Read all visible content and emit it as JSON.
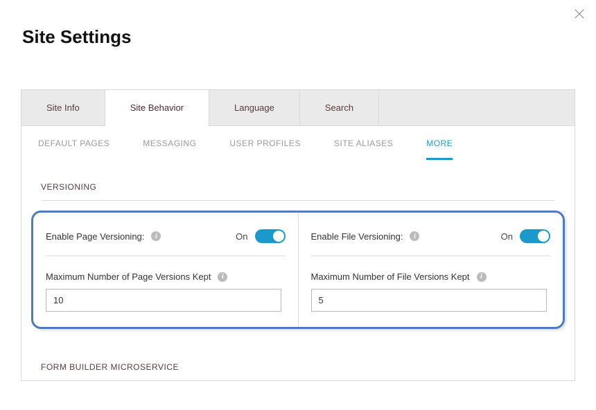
{
  "header": {
    "title": "Site Settings"
  },
  "primaryTabs": [
    {
      "label": "Site Info",
      "active": false
    },
    {
      "label": "Site Behavior",
      "active": true
    },
    {
      "label": "Language",
      "active": false
    },
    {
      "label": "Search",
      "active": false
    }
  ],
  "subTabs": [
    {
      "label": "DEFAULT PAGES",
      "active": false
    },
    {
      "label": "MESSAGING",
      "active": false
    },
    {
      "label": "USER PROFILES",
      "active": false
    },
    {
      "label": "SITE ALIASES",
      "active": false
    },
    {
      "label": "MORE",
      "active": true
    }
  ],
  "versioning": {
    "heading": "VERSIONING",
    "page": {
      "toggleLabel": "Enable Page Versioning:",
      "state": "On",
      "maxLabel": "Maximum Number of Page Versions Kept",
      "maxValue": "10"
    },
    "file": {
      "toggleLabel": "Enable File Versioning:",
      "state": "On",
      "maxLabel": "Maximum Number of File Versions Kept",
      "maxValue": "5"
    }
  },
  "formBuilder": {
    "heading": "FORM BUILDER MICROSERVICE"
  }
}
